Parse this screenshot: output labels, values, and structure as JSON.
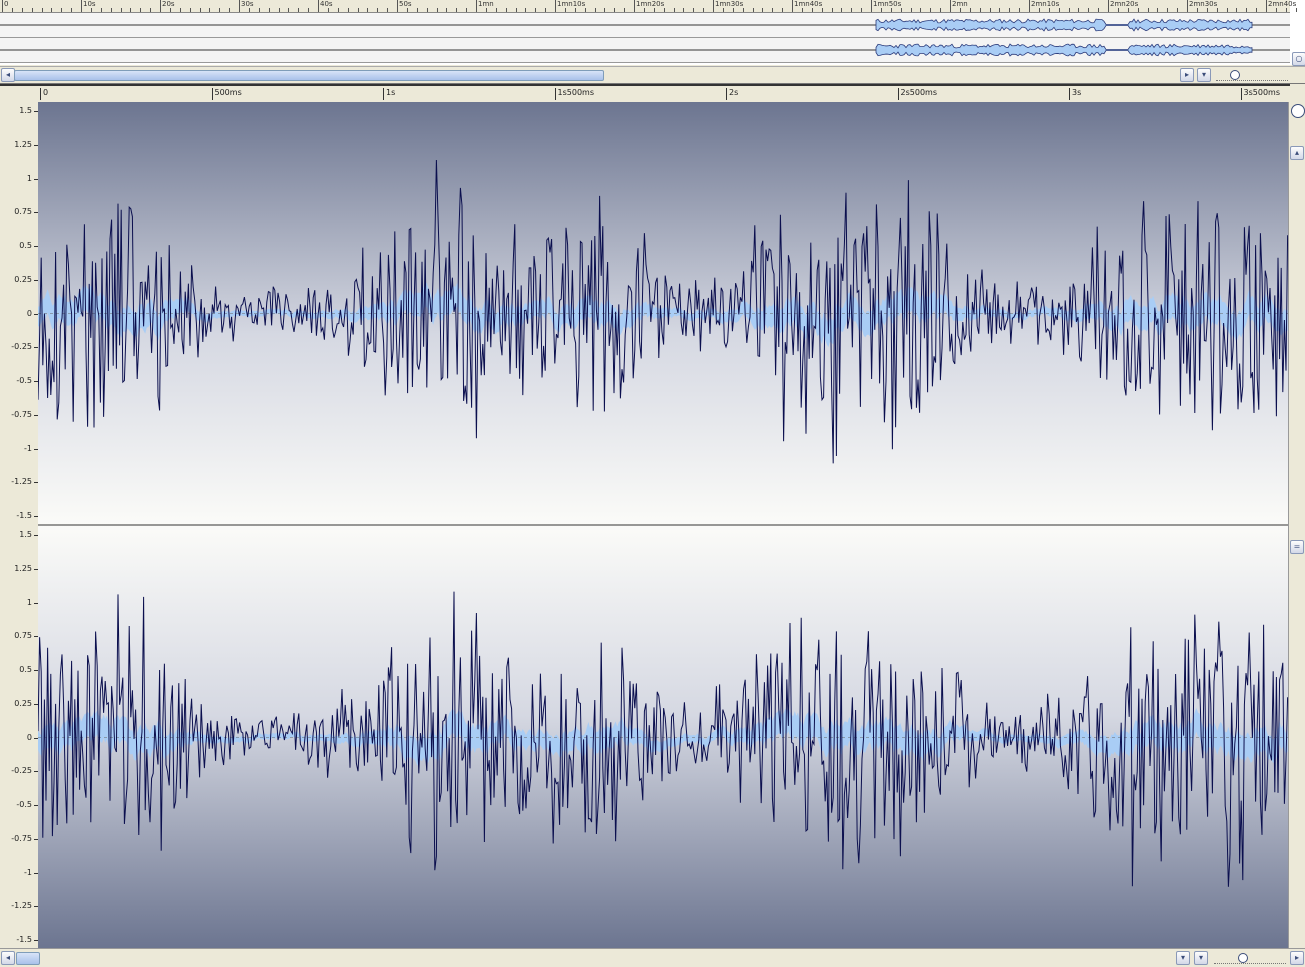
{
  "overview": {
    "ruler_labels": [
      "0",
      "10s",
      "20s",
      "30s",
      "40s",
      "50s",
      "1mn",
      "1mn10s",
      "1mn20s",
      "1mn30s",
      "1mn40s",
      "1mn50s",
      "2mn",
      "2mn10s",
      "2mn20s",
      "2mn30s",
      "2mn40s"
    ]
  },
  "timeline": {
    "labels": [
      "0",
      "500ms",
      "1s",
      "1s500ms",
      "2s",
      "2s500ms",
      "3s",
      "3s500ms"
    ]
  },
  "amplitude": {
    "labels": [
      "1.5",
      "1.25",
      "1",
      "0.75",
      "0.5",
      "0.25",
      "0",
      "-0.25",
      "-0.5",
      "-0.75",
      "-1",
      "-1.25",
      "-1.5"
    ],
    "range": [
      -1.5,
      1.5
    ]
  },
  "icons": {
    "scroll_left": "chevron-left-icon",
    "scroll_right": "chevron-right-icon",
    "dropdown": "chevron-down-icon",
    "zoom": "zoom-slider-icon",
    "scroll_up": "chevron-up-icon"
  },
  "colors": {
    "wave_stroke": "#0b0f4e",
    "wave_fill": "#a9cdf5",
    "bg_dark": "#6c7590",
    "bg_light": "#fbfbf8"
  }
}
